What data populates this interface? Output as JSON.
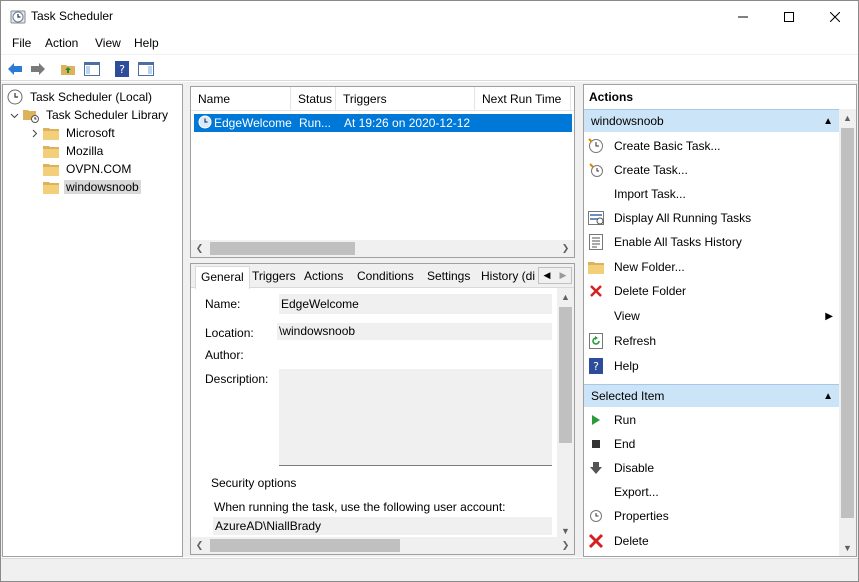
{
  "window": {
    "title": "Task Scheduler"
  },
  "menu": [
    "File",
    "Action",
    "View",
    "Help"
  ],
  "tree": {
    "root": "Task Scheduler (Local)",
    "library": "Task Scheduler Library",
    "folders": [
      "Microsoft",
      "Mozilla",
      "OVPN.COM",
      "windowsnoob"
    ]
  },
  "tasklist": {
    "columns": [
      "Name",
      "Status",
      "Triggers",
      "Next Run Time"
    ],
    "rows": [
      {
        "name": "EdgeWelcome",
        "status": "Run...",
        "triggers": "At 19:26 on 2020-12-12",
        "next": ""
      }
    ]
  },
  "details": {
    "tabs": [
      "General",
      "Triggers",
      "Actions",
      "Conditions",
      "Settings",
      "History (di"
    ],
    "labels": {
      "name": "Name:",
      "location": "Location:",
      "author": "Author:",
      "description": "Description:",
      "security": "Security options",
      "account_prompt": "When running the task, use the following user account:"
    },
    "values": {
      "name": "EdgeWelcome",
      "location": "\\windowsnoob",
      "account": "AzureAD\\NiallBrady"
    }
  },
  "actions": {
    "header": "Actions",
    "folder_section": "windowsnoob",
    "folder_items": [
      "Create Basic Task...",
      "Create Task...",
      "Import Task...",
      "Display All Running Tasks",
      "Enable All Tasks History",
      "New Folder...",
      "Delete Folder",
      "View",
      "Refresh",
      "Help"
    ],
    "selected_section": "Selected Item",
    "selected_items": [
      "Run",
      "End",
      "Disable",
      "Export...",
      "Properties",
      "Delete"
    ]
  },
  "colors": {
    "selection": "#0078d7",
    "section_bg": "#cce4f7",
    "folder": "#dcb35c"
  }
}
